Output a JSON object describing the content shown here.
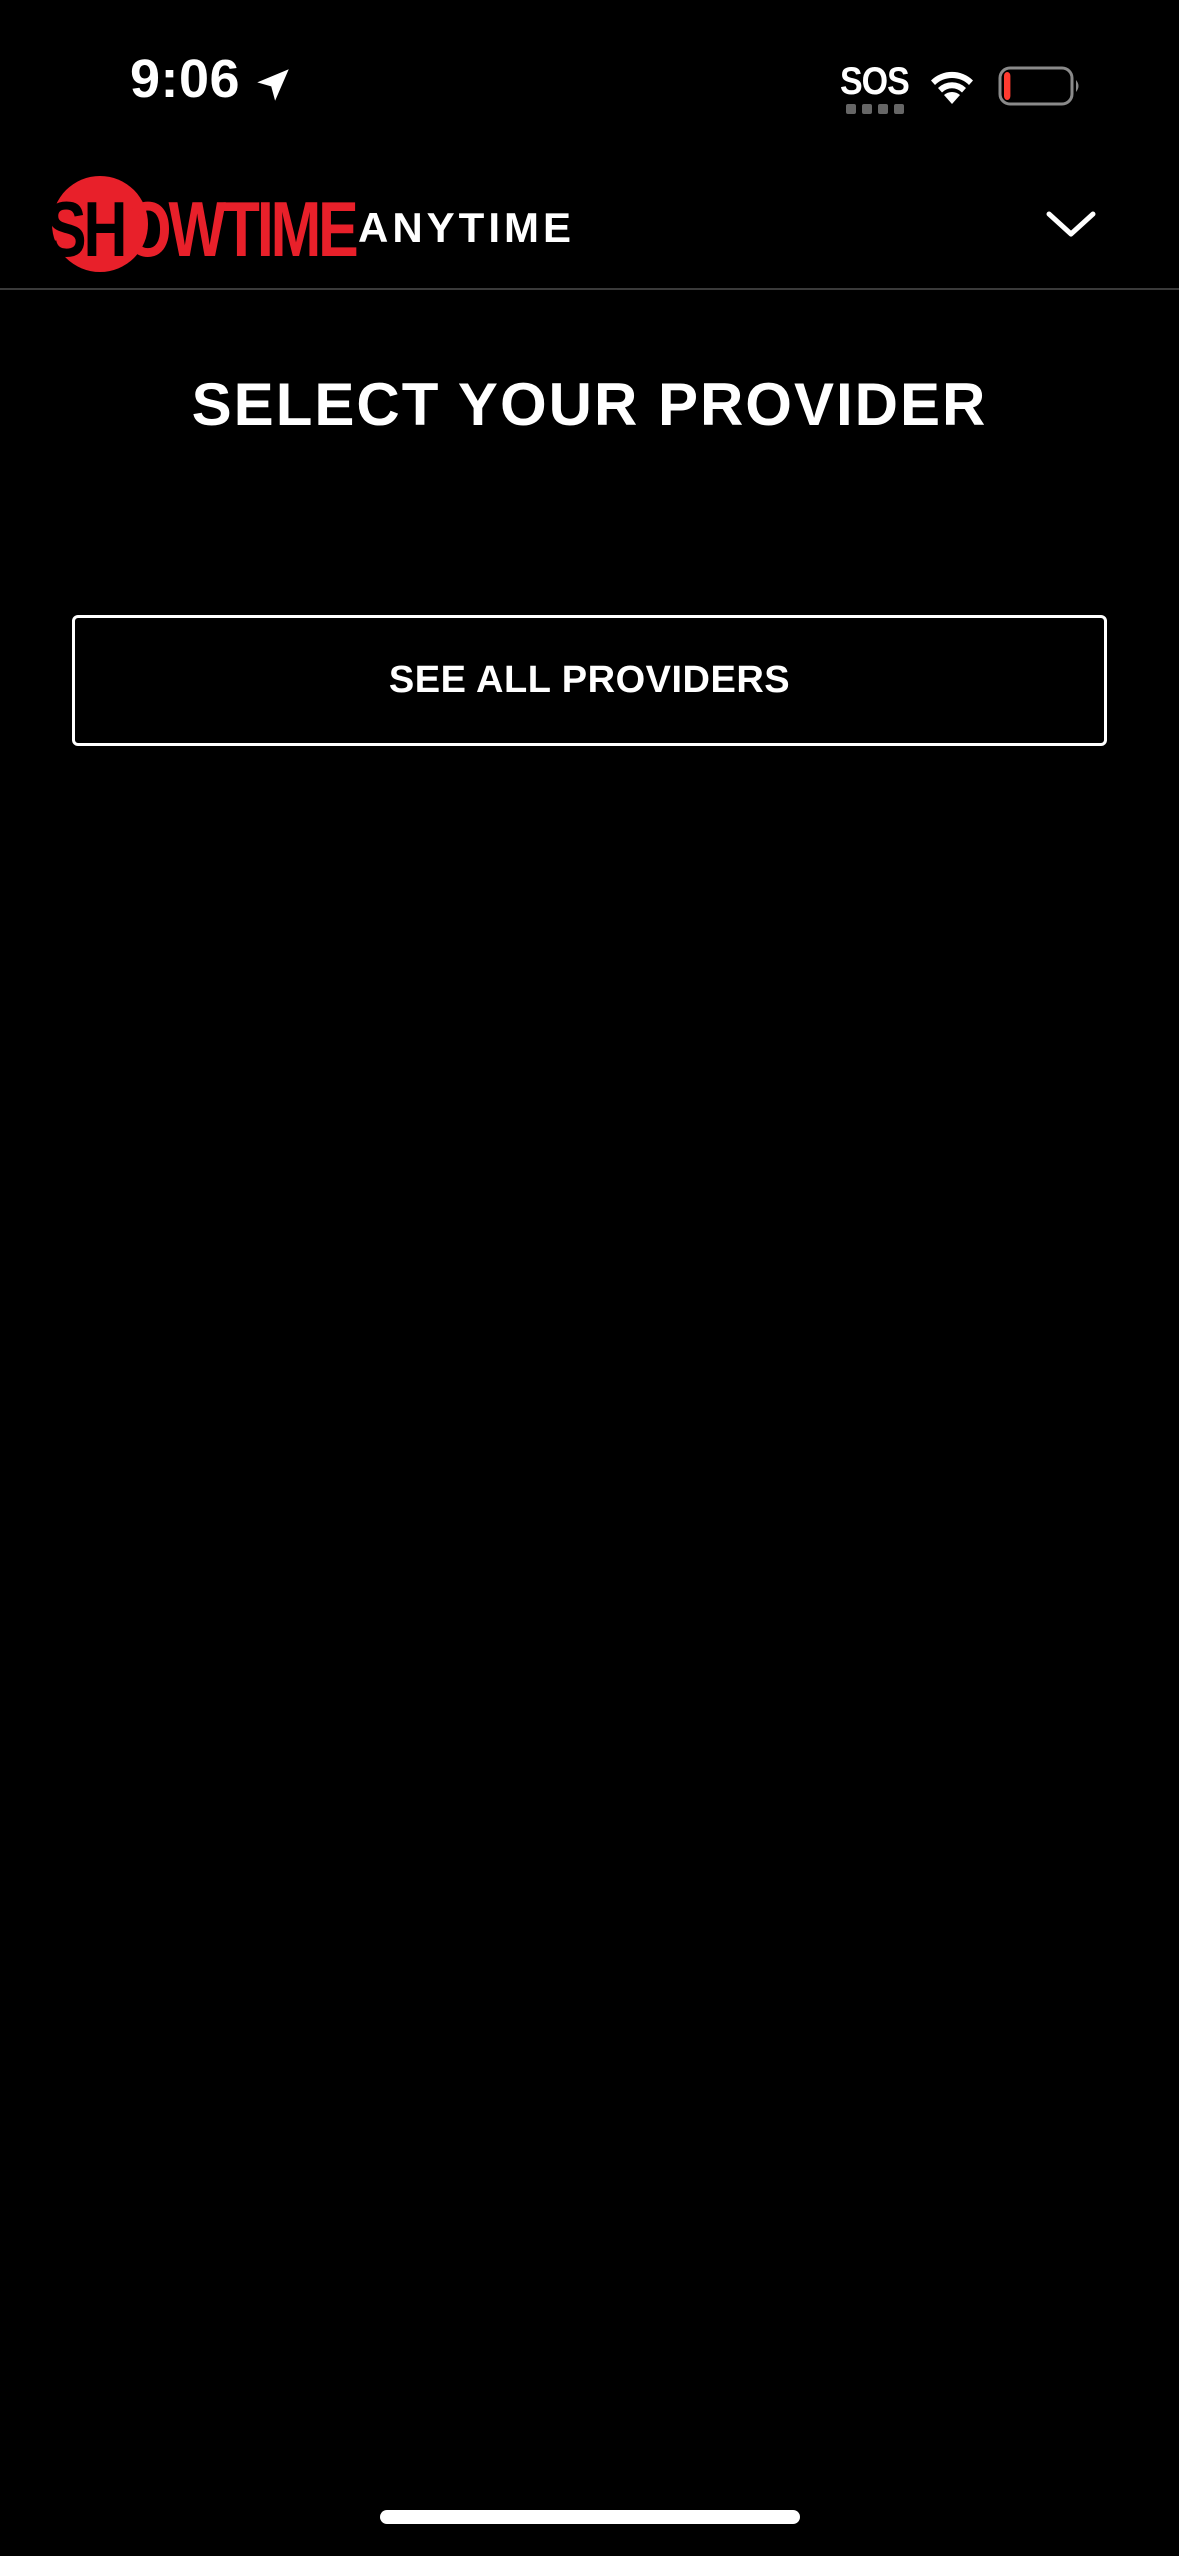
{
  "status_bar": {
    "time": "9:06",
    "sos": "SOS",
    "icons": [
      "location-arrow-icon",
      "wifi-icon",
      "battery-low-icon"
    ],
    "battery_level": 0.1,
    "battery_color": "#ff3b30"
  },
  "header": {
    "logo_text": "SHOWTIME",
    "logo_suffix": "ANYTIME",
    "brand_color": "#e8202a",
    "menu_icon": "chevron-down-icon"
  },
  "main": {
    "title": "SELECT YOUR PROVIDER",
    "see_all_label": "SEE ALL PROVIDERS"
  },
  "colors": {
    "background": "#000000",
    "text": "#ffffff",
    "divider": "#3a3a3a"
  }
}
